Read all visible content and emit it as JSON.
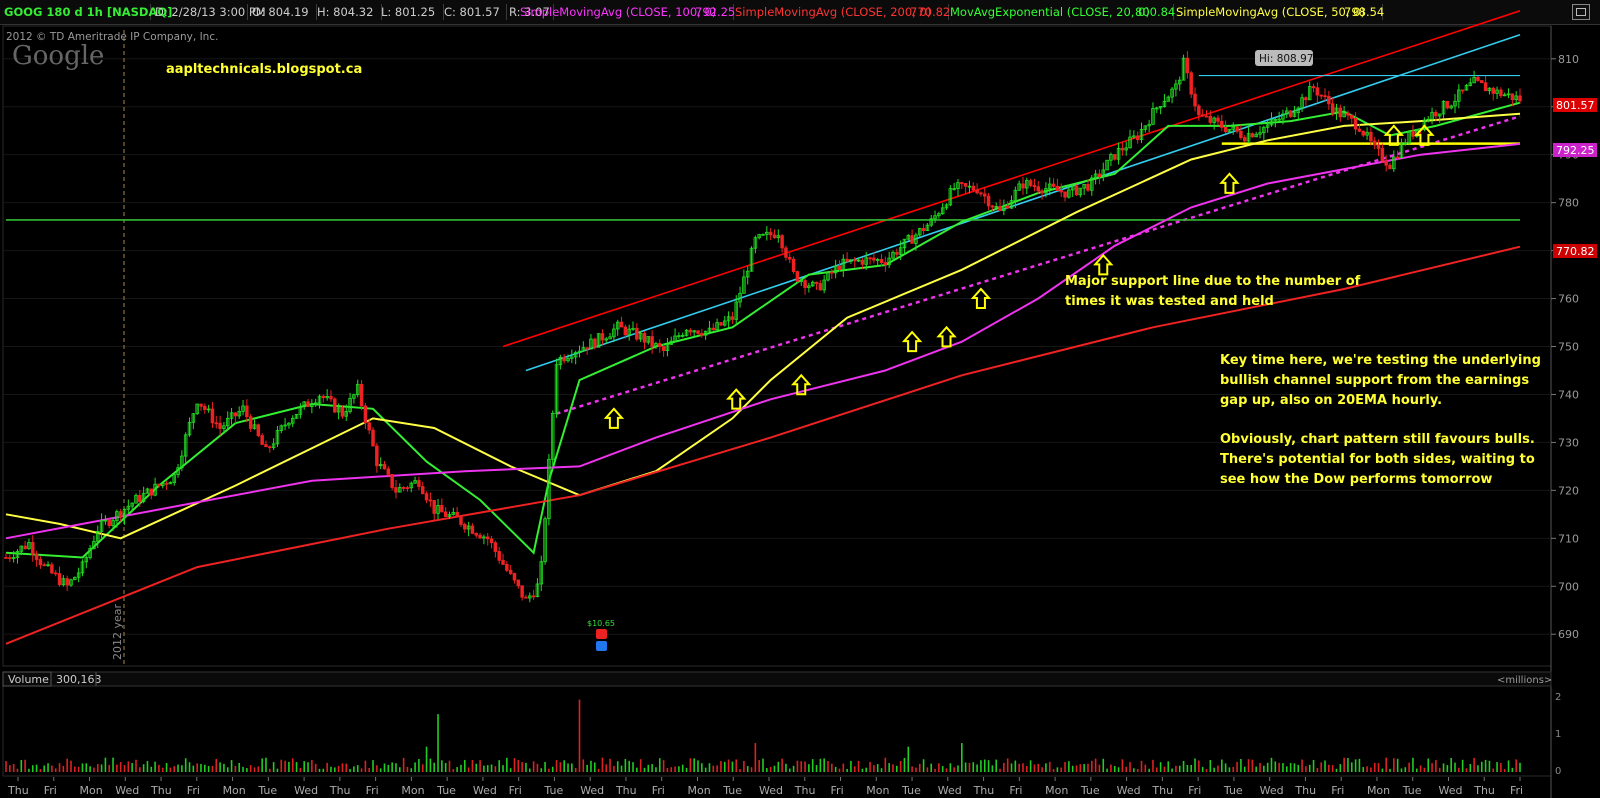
{
  "header": {
    "symbol": "GOOG 180 d 1h [NASDAQ]",
    "date": "D: 2/28/13 3:00 PM",
    "open": "O: 804.19",
    "high": "H: 804.32",
    "low": "L: 801.25",
    "close": "C: 801.57",
    "range": "R: 3.07",
    "studies": [
      {
        "label": "SimpleMovingAvg (CLOSE, 100, 0)",
        "value": "792.25",
        "color": "#ff33ff"
      },
      {
        "label": "SimpleMovingAvg (CLOSE, 200, 0)",
        "value": "770.82",
        "color": "#ff3333"
      },
      {
        "label": "MovAvgExponential (CLOSE, 20, 0)",
        "value": "800.84",
        "color": "#33ff33"
      },
      {
        "label": "SimpleMovingAvg (CLOSE, 50, 0)",
        "value": "798.54",
        "color": "#ffff33"
      }
    ]
  },
  "copyright": "2012 © TD Ameritrade IP Company, Inc.",
  "logo": "Google",
  "watermark_url": "aapltechnicals.blogspot.ca",
  "annotations": {
    "support": [
      "Major support line due to the number of",
      "times it was tested and held"
    ],
    "key": [
      "Key time here, we're testing the underlying",
      "bullish channel support from the earnings",
      "gap up, also on 20EMA hourly.",
      "",
      "Obviously, chart pattern still favours bulls.",
      "There's potential for both sides, waiting to",
      "see how the Dow performs tomorrow"
    ]
  },
  "year_label": "2012 year",
  "low_marker": "$10.65",
  "high_label": "Hi: 808.97",
  "price_badges": [
    {
      "value": "801.57",
      "color": "#dd0000"
    },
    {
      "value": "792.25",
      "color": "#cc22cc"
    },
    {
      "value": "770.82",
      "color": "#cc0000"
    }
  ],
  "volume_panel": {
    "label": "Volume",
    "value": "300,163",
    "units": "<millions>",
    "ticks": [
      "2",
      "1",
      "0"
    ]
  },
  "chart_data": {
    "type": "candlestick",
    "symbol": "GOOG",
    "interval": "1h",
    "span": "180 d",
    "ylim": [
      684,
      816
    ],
    "y_ticks": [
      690,
      700,
      710,
      720,
      730,
      740,
      750,
      760,
      770,
      780,
      790,
      800,
      810
    ],
    "x_day_labels": [
      "Thu",
      "Fri",
      "Mon",
      "Wed",
      "Thu",
      "Fri",
      "Mon",
      "Tue",
      "Wed",
      "Thu",
      "Fri",
      "Mon",
      "Tue",
      "Wed",
      "Fri",
      "Tue",
      "Wed",
      "Thu",
      "Fri",
      "Mon",
      "Tue",
      "Wed",
      "Thu",
      "Fri",
      "Mon",
      "Tue",
      "Wed",
      "Thu",
      "Fri",
      "Mon",
      "Tue",
      "Wed",
      "Thu",
      "Fri",
      "Tue",
      "Wed",
      "Thu",
      "Fri",
      "Mon",
      "Tue",
      "Wed",
      "Thu",
      "Fri"
    ],
    "price_waypoints": [
      [
        0,
        706
      ],
      [
        6,
        709
      ],
      [
        10,
        704
      ],
      [
        16,
        700
      ],
      [
        20,
        704
      ],
      [
        24,
        712
      ],
      [
        34,
        718
      ],
      [
        44,
        723
      ],
      [
        50,
        739
      ],
      [
        56,
        733
      ],
      [
        62,
        737
      ],
      [
        68,
        728
      ],
      [
        74,
        735
      ],
      [
        82,
        740
      ],
      [
        88,
        736
      ],
      [
        92,
        741
      ],
      [
        97,
        726
      ],
      [
        102,
        720
      ],
      [
        108,
        722
      ],
      [
        112,
        716
      ],
      [
        118,
        714
      ],
      [
        126,
        710
      ],
      [
        132,
        702
      ],
      [
        136,
        697
      ],
      [
        139,
        700
      ],
      [
        140,
        704
      ],
      [
        144,
        747
      ],
      [
        148,
        749
      ],
      [
        154,
        751
      ],
      [
        160,
        754
      ],
      [
        166,
        752
      ],
      [
        172,
        749
      ],
      [
        178,
        754
      ],
      [
        184,
        753
      ],
      [
        190,
        756
      ],
      [
        196,
        772
      ],
      [
        202,
        774
      ],
      [
        206,
        765
      ],
      [
        212,
        762
      ],
      [
        218,
        767
      ],
      [
        224,
        768
      ],
      [
        230,
        768
      ],
      [
        236,
        772
      ],
      [
        242,
        776
      ],
      [
        248,
        783
      ],
      [
        254,
        783
      ],
      [
        260,
        778
      ],
      [
        266,
        784
      ],
      [
        272,
        783
      ],
      [
        278,
        782
      ],
      [
        284,
        784
      ],
      [
        290,
        790
      ],
      [
        296,
        794
      ],
      [
        302,
        801
      ],
      [
        306,
        804
      ],
      [
        308,
        808.97
      ],
      [
        312,
        798
      ],
      [
        318,
        796
      ],
      [
        324,
        794
      ],
      [
        330,
        796
      ],
      [
        336,
        799
      ],
      [
        342,
        804
      ],
      [
        348,
        799
      ],
      [
        354,
        796
      ],
      [
        358,
        791
      ],
      [
        362,
        788
      ],
      [
        366,
        793
      ],
      [
        372,
        798
      ],
      [
        378,
        801
      ],
      [
        384,
        805
      ],
      [
        390,
        803
      ],
      [
        396,
        801.57
      ]
    ],
    "moving_averages": {
      "EMA20": [
        [
          0,
          707
        ],
        [
          20,
          706
        ],
        [
          40,
          721
        ],
        [
          60,
          734
        ],
        [
          80,
          738
        ],
        [
          96,
          737
        ],
        [
          110,
          726
        ],
        [
          124,
          718
        ],
        [
          138,
          707
        ],
        [
          142,
          722
        ],
        [
          150,
          743
        ],
        [
          170,
          750
        ],
        [
          190,
          754
        ],
        [
          210,
          765
        ],
        [
          230,
          767
        ],
        [
          250,
          776
        ],
        [
          270,
          782
        ],
        [
          290,
          786
        ],
        [
          304,
          796
        ],
        [
          320,
          796
        ],
        [
          336,
          797
        ],
        [
          350,
          799
        ],
        [
          362,
          794
        ],
        [
          374,
          796
        ],
        [
          396,
          800.84
        ]
      ],
      "SMA50": [
        [
          0,
          715
        ],
        [
          14,
          713
        ],
        [
          30,
          710
        ],
        [
          60,
          721
        ],
        [
          96,
          735
        ],
        [
          112,
          733
        ],
        [
          132,
          725
        ],
        [
          150,
          719
        ],
        [
          170,
          724
        ],
        [
          190,
          735
        ],
        [
          200,
          743
        ],
        [
          220,
          756
        ],
        [
          250,
          766
        ],
        [
          280,
          778
        ],
        [
          310,
          789
        ],
        [
          330,
          793
        ],
        [
          350,
          796
        ],
        [
          370,
          797
        ],
        [
          396,
          798.54
        ]
      ],
      "SMA100": [
        [
          0,
          710
        ],
        [
          40,
          716
        ],
        [
          80,
          722
        ],
        [
          120,
          724
        ],
        [
          150,
          725
        ],
        [
          170,
          731
        ],
        [
          200,
          739
        ],
        [
          230,
          745
        ],
        [
          250,
          751
        ],
        [
          270,
          760
        ],
        [
          290,
          771
        ],
        [
          310,
          779
        ],
        [
          330,
          784
        ],
        [
          350,
          787
        ],
        [
          370,
          790
        ],
        [
          396,
          792.25
        ]
      ],
      "SMA200": [
        [
          0,
          688
        ],
        [
          50,
          704
        ],
        [
          100,
          712
        ],
        [
          150,
          719
        ],
        [
          200,
          731
        ],
        [
          250,
          744
        ],
        [
          300,
          754
        ],
        [
          350,
          762
        ],
        [
          396,
          770.82
        ]
      ]
    },
    "trendlines": [
      {
        "name": "channel-upper-red",
        "points": [
          [
            130,
            750
          ],
          [
            396,
            820
          ]
        ],
        "color": "#ff0000"
      },
      {
        "name": "channel-top-cyan",
        "points": [
          [
            136,
            745
          ],
          [
            396,
            815
          ]
        ],
        "color": "#33ccee"
      },
      {
        "name": "channel-support-dotted",
        "points": [
          [
            144,
            736
          ],
          [
            396,
            798
          ]
        ],
        "color": "#ee33ee"
      },
      {
        "name": "horizontal-support-yellow",
        "points": [
          [
            318,
            792.3
          ],
          [
            396,
            792.3
          ]
        ],
        "color": "#ffff00"
      },
      {
        "name": "horizontal-resistance-cyan",
        "points": [
          [
            312,
            806.5
          ],
          [
            396,
            806.5
          ]
        ],
        "color": "#33ccee"
      },
      {
        "name": "horizontal-green",
        "points": [
          [
            0,
            776.4
          ],
          [
            396,
            776.4
          ]
        ],
        "color": "#33bb33"
      }
    ],
    "volume": {
      "ylim_millions": [
        0,
        2.1
      ],
      "spikes": [
        [
          113,
          1.6
        ],
        [
          150,
          2.0
        ],
        [
          110,
          0.7
        ],
        [
          236,
          0.7
        ],
        [
          196,
          0.8
        ],
        [
          250,
          0.8
        ]
      ]
    }
  }
}
